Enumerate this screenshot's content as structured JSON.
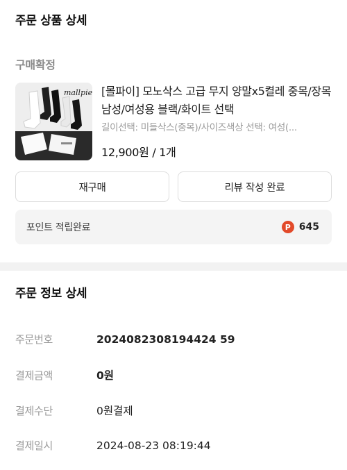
{
  "order_detail": {
    "title": "주문 상품 상세"
  },
  "order_status": "구매확정",
  "product": {
    "name": "[몰파이] 모노삭스 고급 무지 양말x5켤레 중목/장목 남성/여성용 블랙/화이트 선택",
    "options": "길이선택: 미들삭스(중목)/사이즈색상 선택: 여성(...",
    "price_qty": "12,900원 / 1개",
    "image_brand": "mallpie"
  },
  "buttons": {
    "rebuy": "재구매",
    "review": "리뷰 작성 완료"
  },
  "points": {
    "label": "포인트 적립완료",
    "icon_letter": "P",
    "value": "645"
  },
  "order_info": {
    "title": "주문 정보 상세",
    "rows": [
      {
        "label": "주문번호",
        "value": "2024082308194424 59"
      },
      {
        "label": "결제금액",
        "value": "0원"
      },
      {
        "label": "결제수단",
        "value": "0원결제"
      },
      {
        "label": "결제일시",
        "value": "2024-08-23 08:19:44"
      }
    ]
  },
  "colors": {
    "accent_point": "#e24a2a",
    "muted_text": "#9a9a9a"
  }
}
